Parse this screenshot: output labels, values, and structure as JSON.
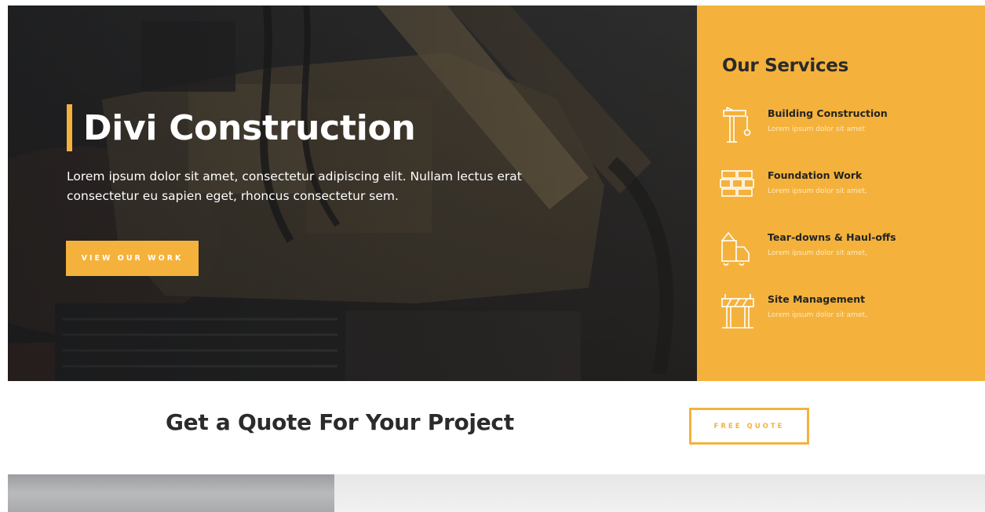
{
  "colors": {
    "accent": "#f4b23c",
    "dark_text": "#2b2b2b",
    "white": "#ffffff"
  },
  "hero": {
    "title": "Divi Construction",
    "description": "Lorem ipsum dolor sit amet, consectetur adipiscing elit. Nullam lectus erat consectetur eu sapien eget, rhoncus consectetur sem.",
    "button_label": "VIEW OUR WORK"
  },
  "services": {
    "title": "Our Services",
    "items": [
      {
        "name": "Building Construction",
        "description": "Lorem ipsum dolor sit amet",
        "icon": "crane-icon"
      },
      {
        "name": "Foundation Work",
        "description": "Lorem ipsum dolor sit amet,",
        "icon": "bricks-icon"
      },
      {
        "name": "Tear-downs & Haul-offs",
        "description": "Lorem ipsum dolor sit amet,",
        "icon": "truck-icon"
      },
      {
        "name": "Site Management",
        "description": "Lorem ipsum dolor sit amet,",
        "icon": "barrier-icon"
      }
    ]
  },
  "quote": {
    "title": "Get a Quote For Your Project",
    "button_label": "FREE QUOTE"
  }
}
